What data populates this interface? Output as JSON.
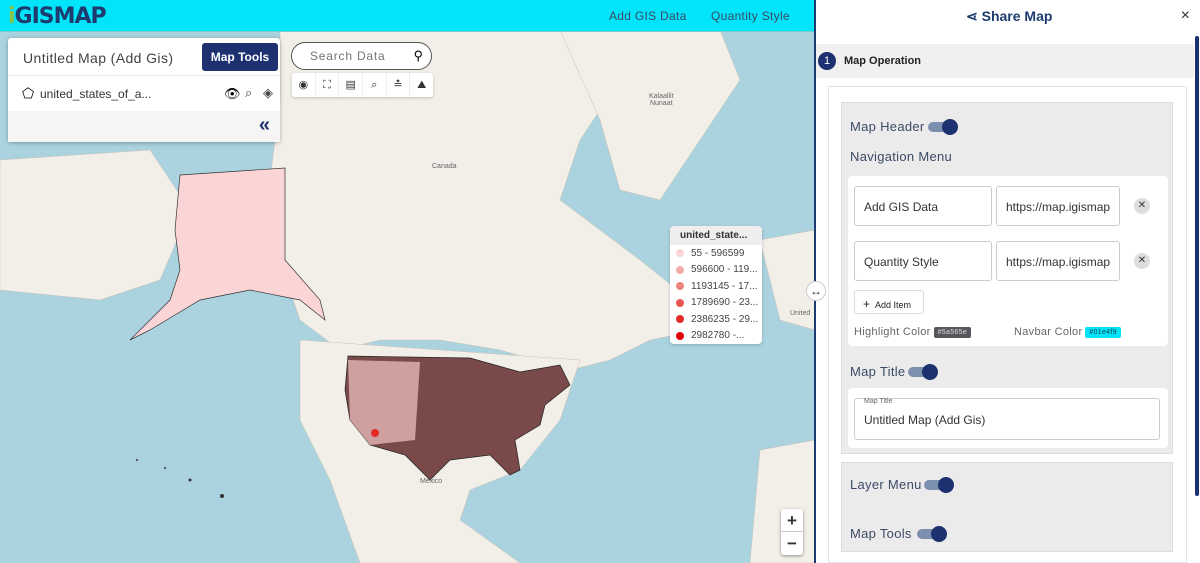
{
  "navbar": {
    "logo": "iGISMAP",
    "items": [
      "Add GIS Data",
      "Quantity Style"
    ],
    "color": "#01e4f9"
  },
  "layer_panel": {
    "title": "Untitled Map (Add Gis)",
    "map_tools": "Map Tools",
    "layer_name": "united_states_of_a...",
    "collapse": "«"
  },
  "search": {
    "placeholder": "Search Data"
  },
  "toolbar": [
    "locate-icon",
    "fullscreen-icon",
    "print-icon",
    "search-icon",
    "measure-icon",
    "basemap-icon"
  ],
  "map_labels": {
    "greenland": "Kalaallit\nNunaat",
    "canada": "Canada",
    "mexico": "México",
    "uk": "United"
  },
  "legend": {
    "title": "united_state...",
    "items": [
      {
        "label": "55 - 596599",
        "color": "#fbd5d5"
      },
      {
        "label": "596600 - 119...",
        "color": "#f5aaaa"
      },
      {
        "label": "1193145 - 17...",
        "color": "#ef8080"
      },
      {
        "label": "1789690 - 23...",
        "color": "#e85555"
      },
      {
        "label": "2386235 - 29...",
        "color": "#e22a2a"
      },
      {
        "label": "2982780 -...",
        "color": "#dc0000"
      }
    ]
  },
  "zoom": {
    "in": "+",
    "out": "−"
  },
  "panel": {
    "title": "Share Map",
    "close": "×",
    "section_num": "1",
    "section": "Map Operation",
    "map_header": "Map Header",
    "navigation_menu": "Navigation Menu",
    "nav_items": [
      {
        "name": "Add GIS Data",
        "url": "https://map.igismap"
      },
      {
        "name": "Quantity Style",
        "url": "https://map.igismap"
      }
    ],
    "add_item": "Add Item",
    "highlight_label": "Highlight Color",
    "highlight_value": "#5a565e",
    "navbar_label": "Navbar Color",
    "navbar_value": "#01e4f9",
    "map_title_label": "Map Title",
    "map_title_field_label": "Map Title",
    "map_title_value": "Untitled Map (Add Gis)",
    "layer_menu": "Layer Menu",
    "map_tools": "Map Tools"
  }
}
